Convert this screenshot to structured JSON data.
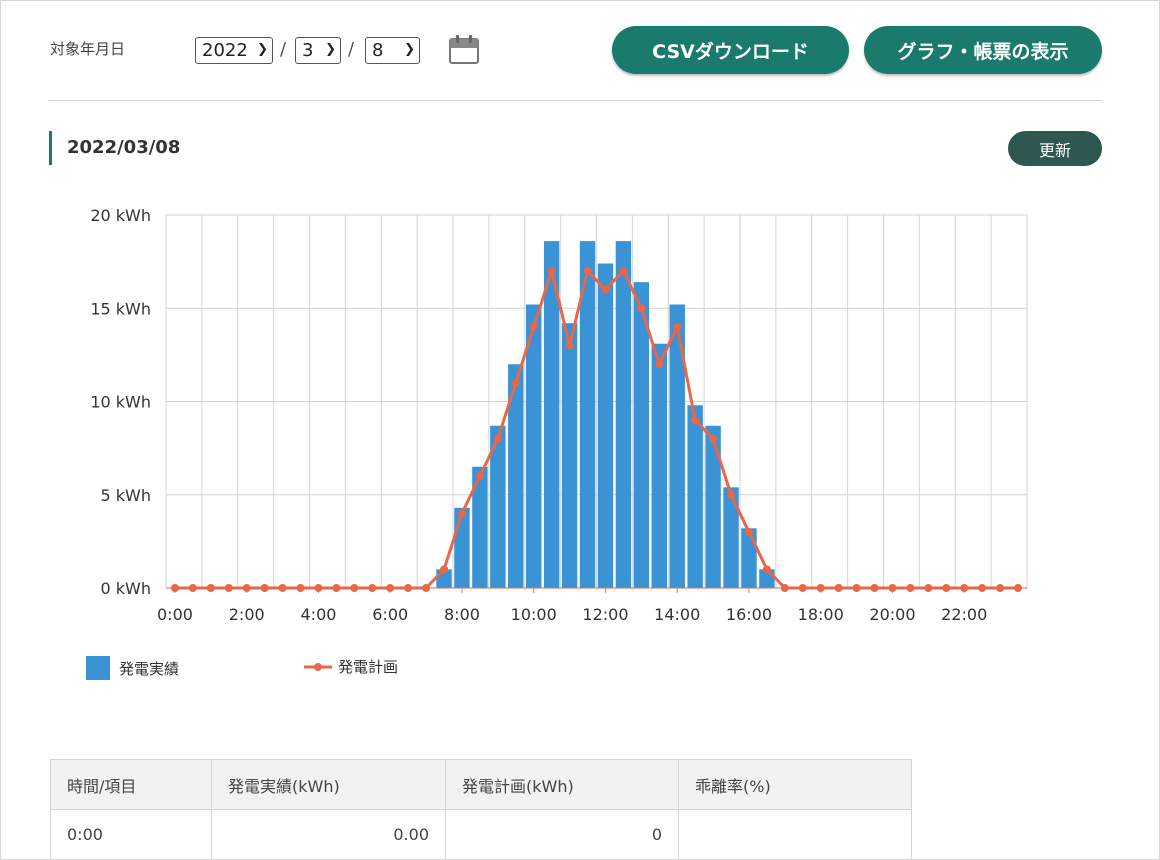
{
  "filter": {
    "label": "対象年月日",
    "year": "2022",
    "month": "3",
    "day": "8",
    "separator": "/"
  },
  "buttons": {
    "csv": "CSVダウンロード",
    "show": "グラフ・帳票の表示",
    "refresh": "更新"
  },
  "section": {
    "date": "2022/03/08"
  },
  "legend": {
    "actual": "発電実績",
    "plan": "発電計画"
  },
  "colors": {
    "bar": "#3a93d5",
    "line": "#e8664a",
    "accent": "#1a7a6c",
    "grid": "#d4d4d4"
  },
  "chart_data": {
    "type": "bar",
    "x": [
      "0:00",
      "0:30",
      "1:00",
      "1:30",
      "2:00",
      "2:30",
      "3:00",
      "3:30",
      "4:00",
      "4:30",
      "5:00",
      "5:30",
      "6:00",
      "6:30",
      "7:00",
      "7:30",
      "8:00",
      "8:30",
      "9:00",
      "9:30",
      "10:00",
      "10:30",
      "11:00",
      "11:30",
      "12:00",
      "12:30",
      "13:00",
      "13:30",
      "14:00",
      "14:30",
      "15:00",
      "15:30",
      "16:00",
      "16:30",
      "17:00",
      "17:30",
      "18:00",
      "18:30",
      "19:00",
      "19:30",
      "20:00",
      "20:30",
      "21:00",
      "21:30",
      "22:00",
      "22:30",
      "23:00",
      "23:30"
    ],
    "x_ticks": [
      "0:00",
      "2:00",
      "4:00",
      "6:00",
      "8:00",
      "10:00",
      "12:00",
      "14:00",
      "16:00",
      "18:00",
      "20:00",
      "22:00"
    ],
    "y_ticks": [
      "0 kWh",
      "5 kWh",
      "10 kWh",
      "15 kWh",
      "20 kWh"
    ],
    "ylim": [
      0,
      20
    ],
    "grid": true,
    "legend_position": "bottom-left",
    "series": [
      {
        "name": "発電実績",
        "type": "bar",
        "values": [
          0,
          0,
          0,
          0,
          0,
          0,
          0,
          0,
          0,
          0,
          0,
          0,
          0,
          0,
          0,
          1.0,
          4.3,
          6.5,
          8.7,
          12.0,
          15.2,
          18.6,
          14.2,
          18.6,
          17.4,
          18.6,
          16.4,
          13.1,
          15.2,
          9.8,
          8.7,
          5.4,
          3.2,
          1.0,
          0,
          0,
          0,
          0,
          0,
          0,
          0,
          0,
          0,
          0,
          0,
          0,
          0,
          0
        ]
      },
      {
        "name": "発電計画",
        "type": "line",
        "values": [
          0,
          0,
          0,
          0,
          0,
          0,
          0,
          0,
          0,
          0,
          0,
          0,
          0,
          0,
          0,
          1,
          4,
          6,
          8,
          11,
          14,
          17,
          13,
          17,
          16,
          17,
          15,
          12,
          14,
          9,
          8,
          5,
          3,
          1,
          0,
          0,
          0,
          0,
          0,
          0,
          0,
          0,
          0,
          0,
          0,
          0,
          0,
          0
        ]
      }
    ]
  },
  "table": {
    "headers": [
      "時間/項目",
      "発電実績(kWh)",
      "発電計画(kWh)",
      "乖離率(%)"
    ],
    "rows": [
      [
        "0:00",
        "0.00",
        "0",
        ""
      ]
    ]
  }
}
